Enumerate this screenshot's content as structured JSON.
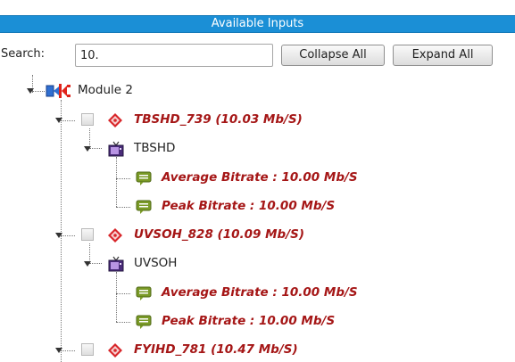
{
  "panel": {
    "title": "Available Inputs",
    "search_label": "Search:",
    "search_value": "10.",
    "collapse_label": "Collapse All",
    "expand_label": "Expand All"
  },
  "tree": {
    "module": {
      "label": "Module 2",
      "icon": "module-icon"
    },
    "services": [
      {
        "label": "TBSHD_739 (10.03 Mb/S)",
        "icon": "service-tag-icon",
        "channel": {
          "label": "TBSHD",
          "icon": "tv-icon"
        },
        "metrics": [
          {
            "label": "Average Bitrate : 10.00 Mb/S",
            "icon": "comment-icon"
          },
          {
            "label": "Peak Bitrate : 10.00 Mb/S",
            "icon": "comment-icon"
          }
        ]
      },
      {
        "label": "UVSOH_828 (10.09 Mb/S)",
        "icon": "service-tag-icon",
        "channel": {
          "label": "UVSOH",
          "icon": "tv-icon"
        },
        "metrics": [
          {
            "label": "Average Bitrate : 10.00 Mb/S",
            "icon": "comment-icon"
          },
          {
            "label": "Peak Bitrate : 10.00 Mb/S",
            "icon": "comment-icon"
          }
        ]
      },
      {
        "label": "FYIHD_781 (10.47 Mb/S)",
        "icon": "service-tag-icon"
      }
    ]
  },
  "colors": {
    "title_bar": "#1b8fd6",
    "highlight_text": "#a51616",
    "comment_icon": "#7a9a26"
  }
}
